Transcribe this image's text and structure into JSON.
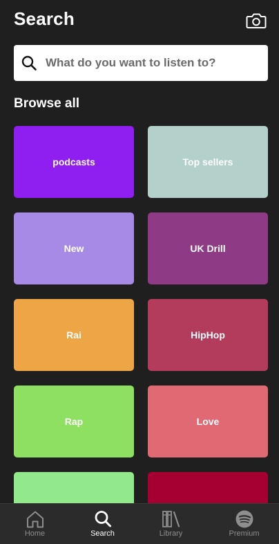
{
  "header": {
    "title": "Search",
    "camera_icon": "camera-icon"
  },
  "search": {
    "placeholder": "What do you want to listen to?",
    "value": ""
  },
  "browse": {
    "heading": "Browse all",
    "tiles": [
      {
        "label": "podcasts",
        "color": "#8f1ff0"
      },
      {
        "label": "Top sellers",
        "color": "#b3d0cb"
      },
      {
        "label": "New",
        "color": "#a78ae6"
      },
      {
        "label": "UK Drill",
        "color": "#8e3a84"
      },
      {
        "label": "Rai",
        "color": "#eea545"
      },
      {
        "label": "HipHop",
        "color": "#b33c5c"
      },
      {
        "label": "Rap",
        "color": "#8ee060"
      },
      {
        "label": "Love",
        "color": "#e06a73"
      },
      {
        "label": "",
        "color": "#92e98c"
      },
      {
        "label": "",
        "color": "#a60033"
      }
    ]
  },
  "nav": {
    "items": [
      {
        "label": "Home",
        "icon": "home-icon",
        "active": false
      },
      {
        "label": "Search",
        "icon": "search-icon",
        "active": true
      },
      {
        "label": "Library",
        "icon": "library-icon",
        "active": false
      },
      {
        "label": "Premium",
        "icon": "spotify-logo-icon",
        "active": false
      }
    ]
  }
}
